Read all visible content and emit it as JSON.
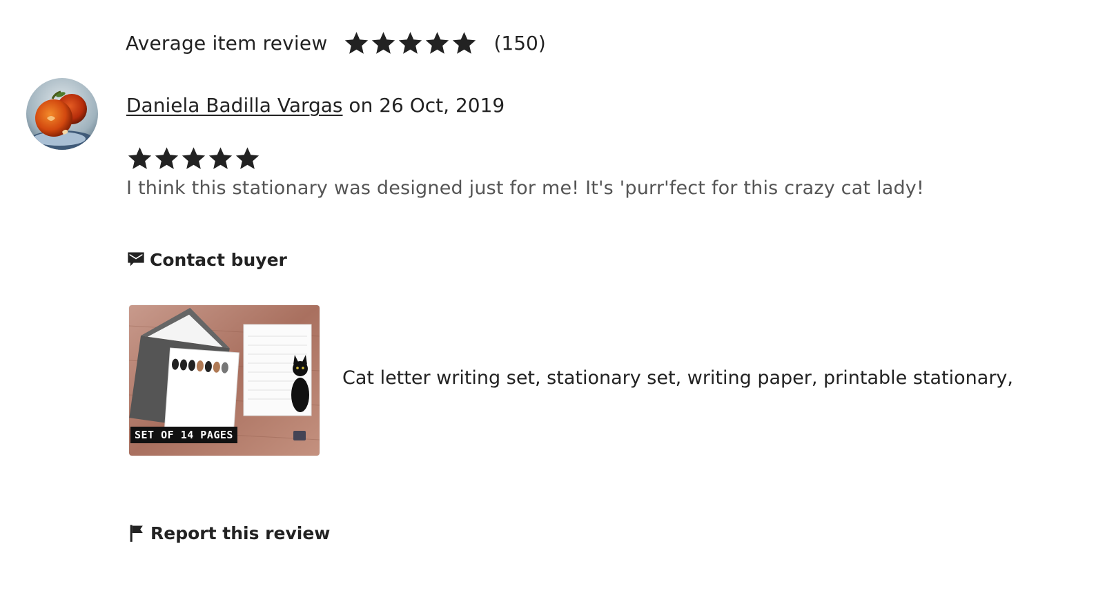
{
  "average": {
    "label": "Average item review",
    "rating": 5,
    "count": "(150)"
  },
  "review": {
    "reviewer_name": "Daniela Badilla Vargas",
    "date_text": " on 26 Oct, 2019",
    "rating": 5,
    "text": "I think this stationary was designed just for me! It's 'purr'fect for this crazy cat lady!"
  },
  "actions": {
    "contact_label": "Contact buyer",
    "report_label": "Report this review"
  },
  "product": {
    "title": "Cat letter writing set, stationary set, writing paper, printable stationary,",
    "thumb_badge": "SET OF 14 PAGES"
  },
  "colors": {
    "text": "#222222",
    "muted_text": "#555555",
    "star": "#222222"
  },
  "icons": {
    "star": "star-icon",
    "contact": "message-icon",
    "report": "flag-icon"
  }
}
